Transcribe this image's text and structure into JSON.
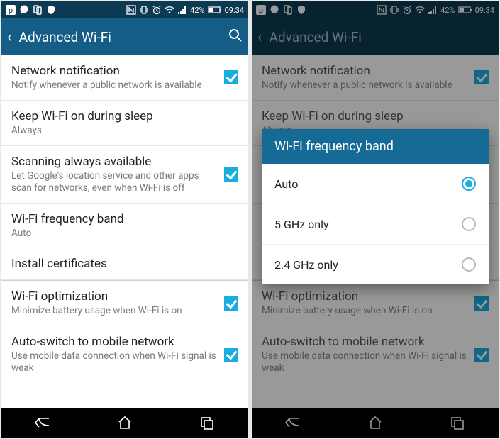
{
  "status": {
    "battery_pct": "42%",
    "time": "09:34"
  },
  "header": {
    "title": "Advanced Wi-Fi"
  },
  "settings": {
    "network_notification": {
      "title": "Network notification",
      "sub": "Notify whenever a public network is available"
    },
    "keep_wifi": {
      "title": "Keep Wi-Fi on during sleep",
      "sub": "Always"
    },
    "scanning": {
      "title": "Scanning always available",
      "sub": "Let Google's location service and other apps scan for networks, even when Wi-Fi is off"
    },
    "freq_band": {
      "title": "Wi-Fi frequency band",
      "sub": "Auto"
    },
    "install_certs": {
      "title": "Install certificates"
    },
    "optimization": {
      "title": "Wi-Fi optimization",
      "sub": "Minimize battery usage when Wi-Fi is on"
    },
    "auto_switch": {
      "title": "Auto-switch to mobile network",
      "sub": "Use mobile data connection when Wi-Fi signal is weak"
    }
  },
  "dialog": {
    "title": "Wi-Fi frequency band",
    "options": [
      "Auto",
      "5 GHz only",
      "2.4 GHz only"
    ]
  }
}
